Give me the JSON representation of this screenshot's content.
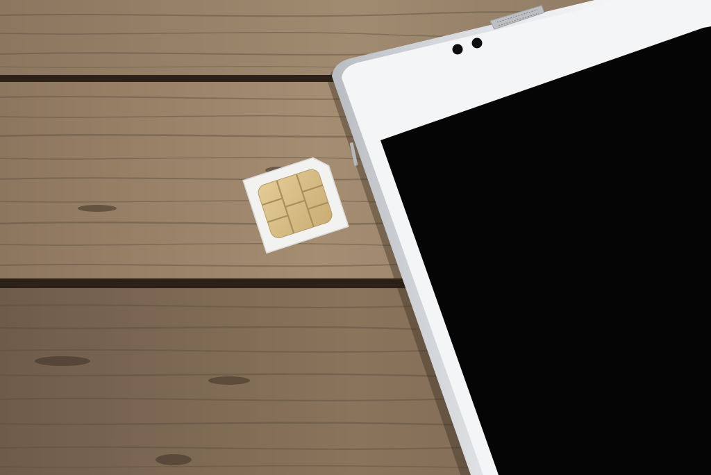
{
  "scene": {
    "subject": "phone-and-sim-card",
    "colors": {
      "wood_light": "#9a836a",
      "wood_mid": "#7d6a56",
      "wood_dark": "#5e4e3f",
      "plank_gap": "#2b2118",
      "phone_body": "#f4f5f6",
      "phone_edge": "#c9ccd0",
      "screen": "#050505",
      "sim_card": "#f2f2f0",
      "sim_chip": "#d9c08a",
      "sim_chip_line": "#a88f5c"
    }
  }
}
